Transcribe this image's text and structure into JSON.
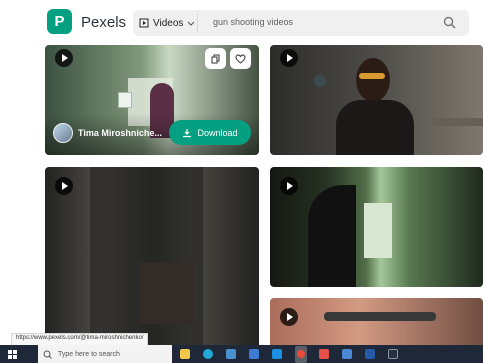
{
  "app": {
    "name": "Pexels",
    "logo_letter": "P"
  },
  "search": {
    "category": "Videos",
    "query": "gun shooting videos"
  },
  "featured_video": {
    "author": "Tima Miroshniche...",
    "download_label": "Download"
  },
  "statusbar": {
    "url": "https://www.pexels.com/@tima-miroshnichenko/"
  },
  "taskbar": {
    "search_placeholder": "Type here to search",
    "apps": [
      "explorer-icon",
      "edge-icon",
      "files-icon",
      "store-icon",
      "mail-icon",
      "chrome-icon",
      "media-icon",
      "docs-icon",
      "word-icon",
      "terminal-icon"
    ]
  }
}
